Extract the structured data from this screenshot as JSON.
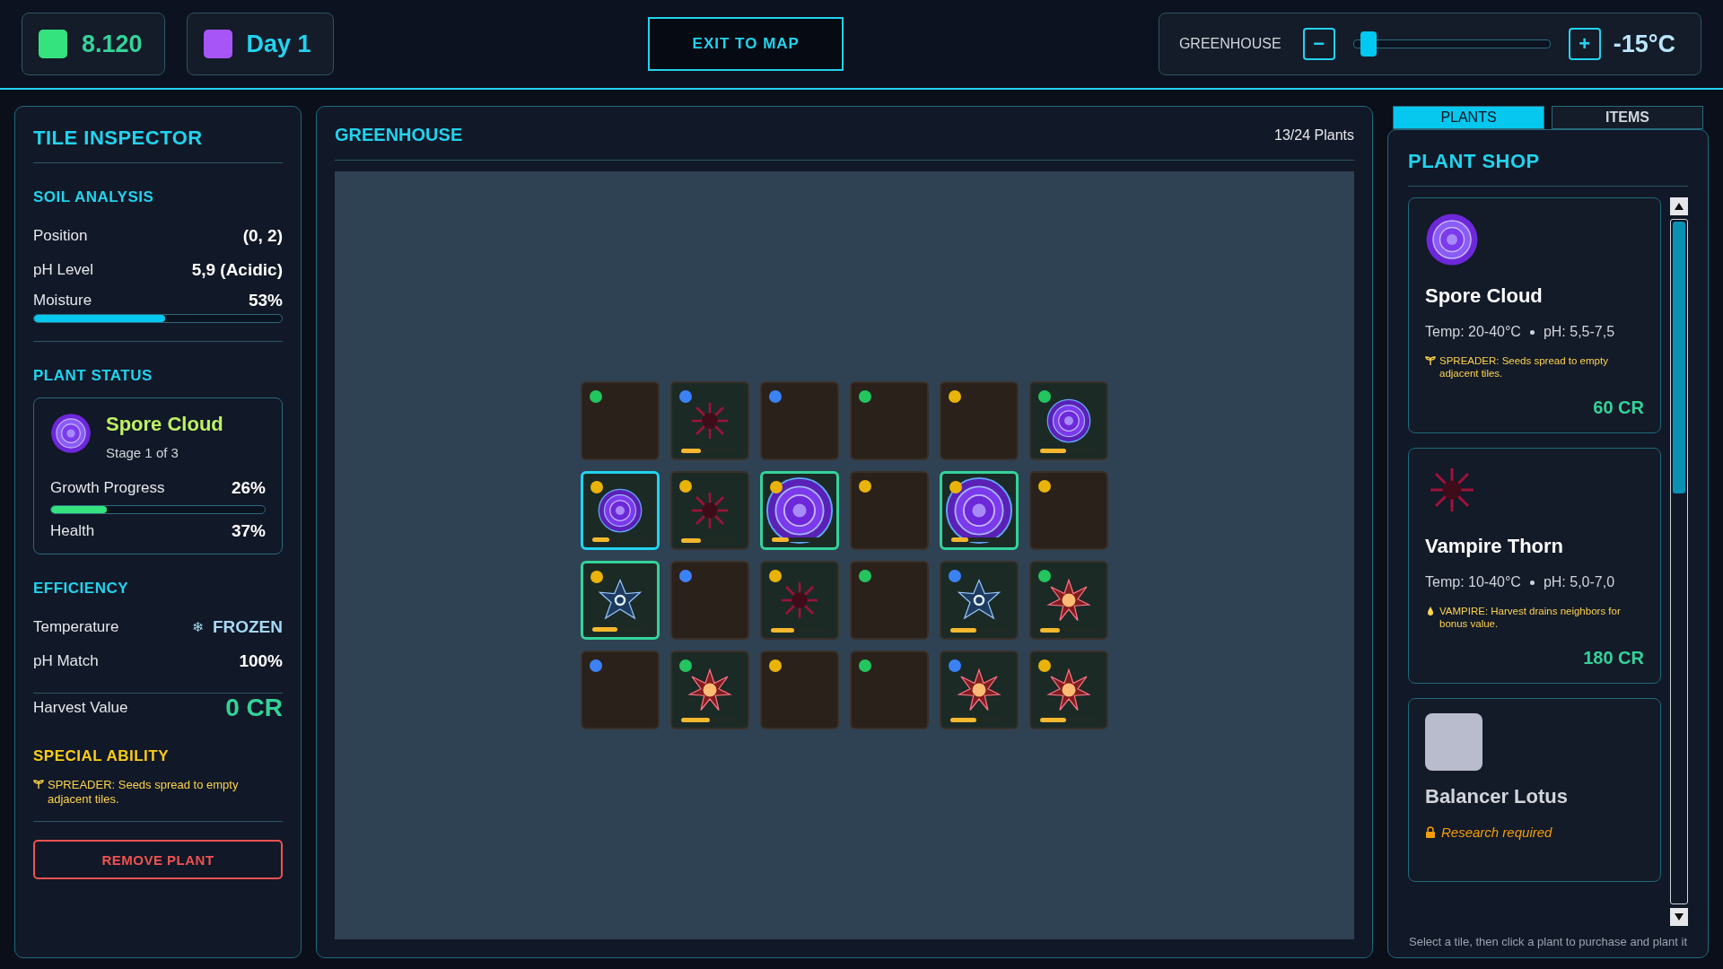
{
  "topbar": {
    "credits": {
      "value": "8.120"
    },
    "day": {
      "value": "Day 1"
    },
    "exit_button": "EXIT TO MAP",
    "climate": {
      "label": "GREENHOUSE",
      "minus": "−",
      "plus": "+",
      "level": 0.08,
      "reading": "-15°C"
    }
  },
  "inspector": {
    "title": "TILE INSPECTOR",
    "soil": {
      "heading": "SOIL ANALYSIS",
      "position_label": "Position",
      "position": "(0, 2)",
      "ph_label": "pH Level",
      "ph": "5,9 (Acidic)",
      "moisture_label": "Moisture",
      "moisture": {
        "value": "53%",
        "level": 0.53
      }
    },
    "plant": {
      "heading": "PLANT STATUS",
      "name": "Spore Cloud",
      "stage": "Stage 1 of 3",
      "growth_label": "Growth Progress",
      "growth": {
        "value": "26%",
        "level": 0.26
      },
      "health_label": "Health",
      "health": "37%"
    },
    "efficiency": {
      "heading": "EFFICIENCY",
      "temp_label": "Temperature",
      "temp_icon": "❄",
      "temp": "FROZEN",
      "ph_label": "pH Match",
      "ph": "100%"
    },
    "harvest_label": "Harvest Value",
    "harvest": "0 CR",
    "ability": {
      "heading": "SPECIAL ABILITY",
      "text": "SPREADER: Seeds spread to empty adjacent tiles."
    },
    "remove_button": "REMOVE PLANT"
  },
  "greenhouse": {
    "title": "GREENHOUSE",
    "count": "13/24 Plants",
    "tiles": [
      [
        {
          "color": "#22c55e",
          "kind": "empty",
          "selected": false,
          "ready": false
        },
        {
          "color": "#3b82f6",
          "kind": "vampire",
          "level": 0.35,
          "selected": false,
          "ready": false
        },
        {
          "color": "#3b82f6",
          "kind": "empty",
          "selected": false,
          "ready": false
        },
        {
          "color": "#22c55e",
          "kind": "empty",
          "selected": false,
          "ready": false
        },
        {
          "color": "#eab308",
          "kind": "empty",
          "selected": false,
          "ready": false
        },
        {
          "color": "#22c55e",
          "kind": "spore",
          "level": 0.45,
          "selected": false,
          "ready": false
        }
      ],
      [
        {
          "color": "#eab308",
          "kind": "spore",
          "level": 0.3,
          "selected": true,
          "ready": false
        },
        {
          "color": "#eab308",
          "kind": "vampire",
          "level": 0.35,
          "selected": false,
          "ready": false
        },
        {
          "color": "#eab308",
          "kind": "spore",
          "level": 0.3,
          "selected": false,
          "ready": true
        },
        {
          "color": "#eab308",
          "kind": "empty",
          "selected": false,
          "ready": false
        },
        {
          "color": "#eab308",
          "kind": "spore",
          "level": 0.3,
          "selected": false,
          "ready": true
        },
        {
          "color": "#eab308",
          "kind": "empty",
          "selected": false,
          "ready": false
        }
      ],
      [
        {
          "color": "#eab308",
          "kind": "star",
          "level": 0.45,
          "selected": false,
          "ready": true
        },
        {
          "color": "#3b82f6",
          "kind": "empty",
          "selected": false,
          "ready": false
        },
        {
          "color": "#eab308",
          "kind": "vampire",
          "level": 0.4,
          "selected": false,
          "ready": false
        },
        {
          "color": "#22c55e",
          "kind": "empty",
          "selected": false,
          "ready": false
        },
        {
          "color": "#3b82f6",
          "kind": "star",
          "level": 0.45,
          "selected": false,
          "ready": false
        },
        {
          "color": "#22c55e",
          "kind": "flame",
          "level": 0.35,
          "selected": false,
          "ready": false
        }
      ],
      [
        {
          "color": "#3b82f6",
          "kind": "empty",
          "selected": false,
          "ready": false
        },
        {
          "color": "#22c55e",
          "kind": "flame",
          "level": 0.5,
          "selected": false,
          "ready": false
        },
        {
          "color": "#eab308",
          "kind": "empty",
          "selected": false,
          "ready": false
        },
        {
          "color": "#22c55e",
          "kind": "empty",
          "selected": false,
          "ready": false
        },
        {
          "color": "#3b82f6",
          "kind": "flame",
          "level": 0.45,
          "selected": false,
          "ready": false
        },
        {
          "color": "#eab308",
          "kind": "flame",
          "level": 0.45,
          "selected": false,
          "ready": false
        }
      ]
    ]
  },
  "shop": {
    "tabs": [
      {
        "label": "PLANTS",
        "selected": true
      },
      {
        "label": "ITEMS",
        "selected": false
      }
    ],
    "title": "PLANT SHOP",
    "items": [
      {
        "name": "Spore Cloud",
        "kind": "spore",
        "locked": false,
        "temp": "Temp: 20-40°C",
        "ph": "pH: 5,5-7,5",
        "ability": {
          "kind": "sprout",
          "text": "SPREADER: Seeds spread to empty adjacent tiles."
        },
        "price": "60 CR"
      },
      {
        "name": "Vampire Thorn",
        "kind": "vampire",
        "locked": false,
        "temp": "Temp: 10-40°C",
        "ph": "pH: 5,0-7,0",
        "ability": {
          "kind": "drop",
          "text": "VAMPIRE: Harvest drains neighbors for bonus value."
        },
        "price": "180 CR"
      },
      {
        "name": "Balancer Lotus",
        "locked": true,
        "note": "Research required"
      }
    ],
    "hint": "Select a tile, then click a plant to purchase and plant it"
  }
}
